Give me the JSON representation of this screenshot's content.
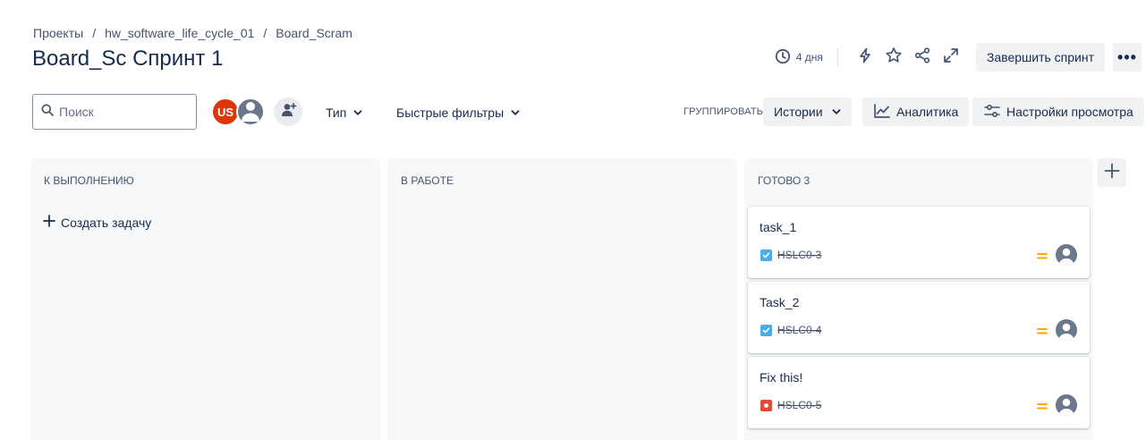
{
  "breadcrumb": {
    "items": [
      "Проекты",
      "hw_software_life_cycle_01",
      "Board_Scram"
    ],
    "separator": "/"
  },
  "page_title": "Board_Sc Спринт 1",
  "sprint": {
    "days_left": "4 дня"
  },
  "actions": {
    "complete_sprint": "Завершить спринт",
    "more": "•••"
  },
  "search": {
    "placeholder": "Поиск",
    "value": ""
  },
  "avatars": {
    "us_initials": "US"
  },
  "filters": {
    "type_label": "Тип",
    "quick_filters_label": "Быстрые фильтры"
  },
  "grouping": {
    "label": "ГРУППИРОВАТЬ",
    "value": "Истории"
  },
  "analytics_label": "Аналитика",
  "view_settings_label": "Настройки просмотра",
  "columns": [
    {
      "title": "К ВЫПОЛНЕНИЮ",
      "create_label": "Создать задачу"
    },
    {
      "title": "В РАБОТЕ"
    },
    {
      "title": "ГОТОВО 3"
    }
  ],
  "cards": [
    {
      "title": "task_1",
      "key": "HSLC0-3",
      "type": "task",
      "priority": "medium"
    },
    {
      "title": "Task_2",
      "key": "HSLC0-4",
      "type": "task",
      "priority": "medium"
    },
    {
      "title": "Fix this!",
      "key": "HSLC0-5",
      "type": "bug",
      "priority": "medium"
    }
  ],
  "colors": {
    "task": "#4bade8",
    "bug": "#e5493a",
    "priority_medium": "#ffab00",
    "avatar_us": "#de350b"
  },
  "icons": {
    "clock": "clock-icon",
    "bolt": "lightning-icon",
    "star": "star-icon",
    "share": "share-icon",
    "expand": "expand-icon",
    "search": "search-icon",
    "add_people": "add-people-icon",
    "chevron": "chevron-down-icon",
    "analytics": "analytics-icon",
    "settings": "sliders-icon",
    "plus": "plus-icon"
  }
}
